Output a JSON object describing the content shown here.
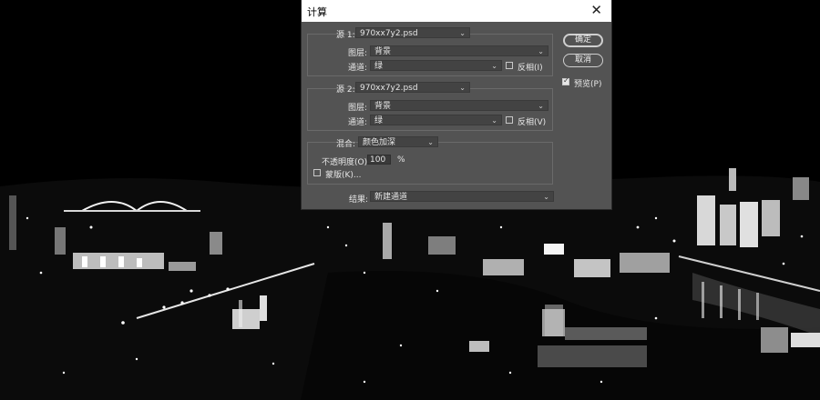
{
  "dialog": {
    "title": "计算",
    "close_glyph": "✕",
    "source1": {
      "label": "源 1:",
      "file": "970xx7y2.psd",
      "layer_label": "图层:",
      "layer": "背景",
      "channel_label": "通道:",
      "channel": "绿",
      "invert_label": "反相(I)",
      "invert_checked": false
    },
    "source2": {
      "label": "源 2:",
      "file": "970xx7y2.psd",
      "layer_label": "图层:",
      "layer": "背景",
      "channel_label": "通道:",
      "channel": "绿",
      "invert_label": "反相(V)",
      "invert_checked": false
    },
    "blending": {
      "label": "混合:",
      "mode": "颜色加深",
      "opacity_label": "不透明度(O):",
      "opacity_value": "100",
      "opacity_unit": "%",
      "mask_label": "蒙版(K)...",
      "mask_checked": false
    },
    "result": {
      "label": "结果:",
      "value": "新建通道"
    },
    "buttons": {
      "ok": "确定",
      "cancel": "取消"
    },
    "preview": {
      "label": "预览(P)",
      "checked": true
    }
  },
  "icons": {
    "dropdown": "chevron-down-icon",
    "close": "close-icon",
    "checkbox_check": "check-icon"
  },
  "colors": {
    "dialog_bg": "#535353",
    "field_bg": "#434343",
    "titlebar_bg": "#ffffff",
    "canvas_bg": "#000000"
  }
}
